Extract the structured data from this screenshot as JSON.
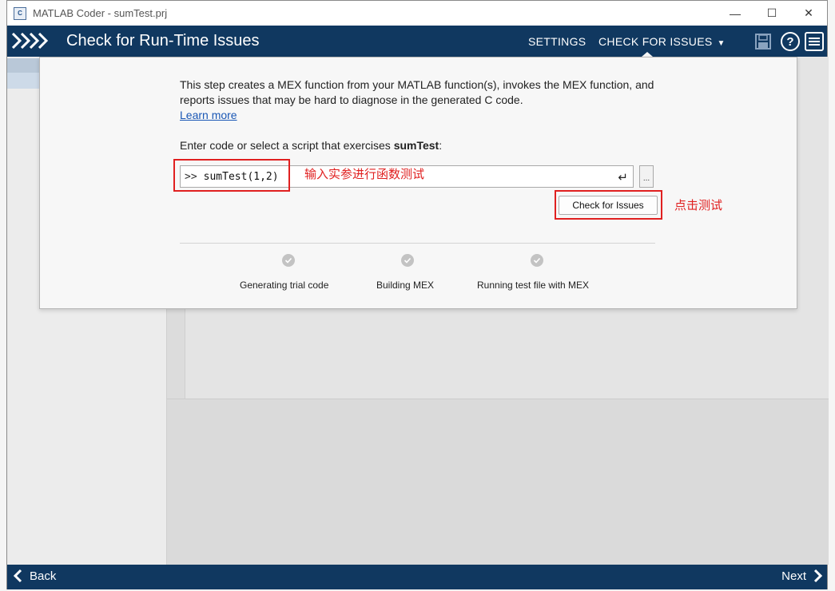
{
  "window": {
    "title": "MATLAB Coder - sumTest.prj",
    "minimize_glyph": "—",
    "maximize_glyph": "☐",
    "close_glyph": "✕"
  },
  "header": {
    "title": "Check for Run-Time Issues",
    "settings_label": "SETTINGS",
    "check_label": "CHECK FOR ISSUES",
    "check_caret": "▼",
    "help_glyph": "?",
    "color": "#103860"
  },
  "panel": {
    "description": "This step creates a MEX function from your MATLAB function(s), invokes the MEX function, and reports issues that may be hard to diagnose in the generated C code.",
    "learn_more": "Learn more",
    "prompt_text": "Enter code or select a script that exercises ",
    "prompt_function": "sumTest",
    "prompt_colon": ":",
    "code_prompt": ">>",
    "code_value": "sumTest(1,2)",
    "enter_glyph": "↵",
    "browse_label": "...",
    "check_button": "Check for Issues",
    "steps": [
      {
        "label": "Generating trial code",
        "state": "pending"
      },
      {
        "label": "Building MEX",
        "state": "pending"
      },
      {
        "label": "Running test file with MEX",
        "state": "pending"
      }
    ]
  },
  "annotations": {
    "input_note": "输入实参进行函数测试",
    "button_note": "点击测试",
    "color": "#e02020"
  },
  "footer": {
    "back_label": "Back",
    "next_label": "Next"
  }
}
